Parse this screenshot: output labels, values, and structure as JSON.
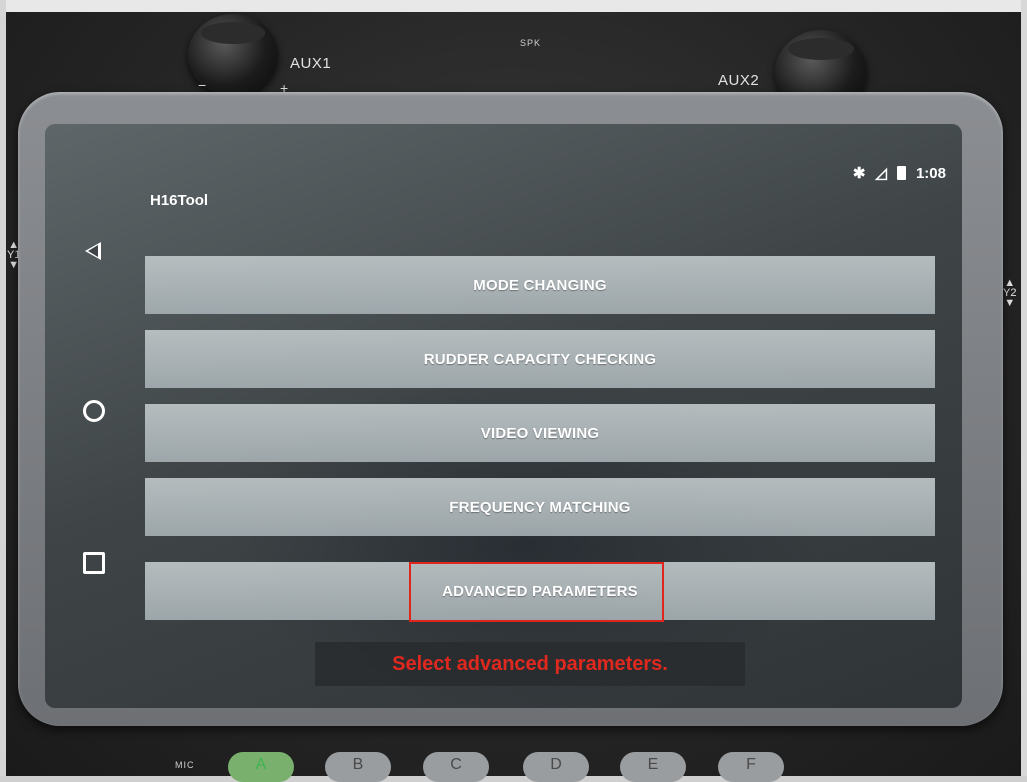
{
  "device": {
    "knob_left_label": "AUX1",
    "knob_right_label": "AUX2",
    "speaker_label": "SPK",
    "mic_label": "MIC",
    "minus": "−",
    "plus": "+",
    "stick_left": "Y1",
    "stick_right": "Y2",
    "buttons": [
      "A",
      "B",
      "C",
      "D",
      "E",
      "F"
    ]
  },
  "status_bar": {
    "bluetooth_icon": "bluetooth-icon",
    "signal_icon": "signal-icon",
    "battery_icon": "battery-icon",
    "battery_value": "70",
    "time": "1:08"
  },
  "app": {
    "title": "H16Tool"
  },
  "nav": {
    "back_icon": "back-triangle-icon",
    "home_icon": "home-circle-icon",
    "recent_icon": "recent-square-icon"
  },
  "menu": {
    "items": [
      {
        "label": "MODE CHANGING"
      },
      {
        "label": "RUDDER CAPACITY CHECKING"
      },
      {
        "label": "VIDEO VIEWING"
      },
      {
        "label": "FREQUENCY MATCHING"
      },
      {
        "label": "ADVANCED PARAMETERS"
      }
    ],
    "highlighted_index": 4
  },
  "annotation": {
    "caption": "Select advanced parameters.",
    "highlight_color": "#e0251d"
  }
}
